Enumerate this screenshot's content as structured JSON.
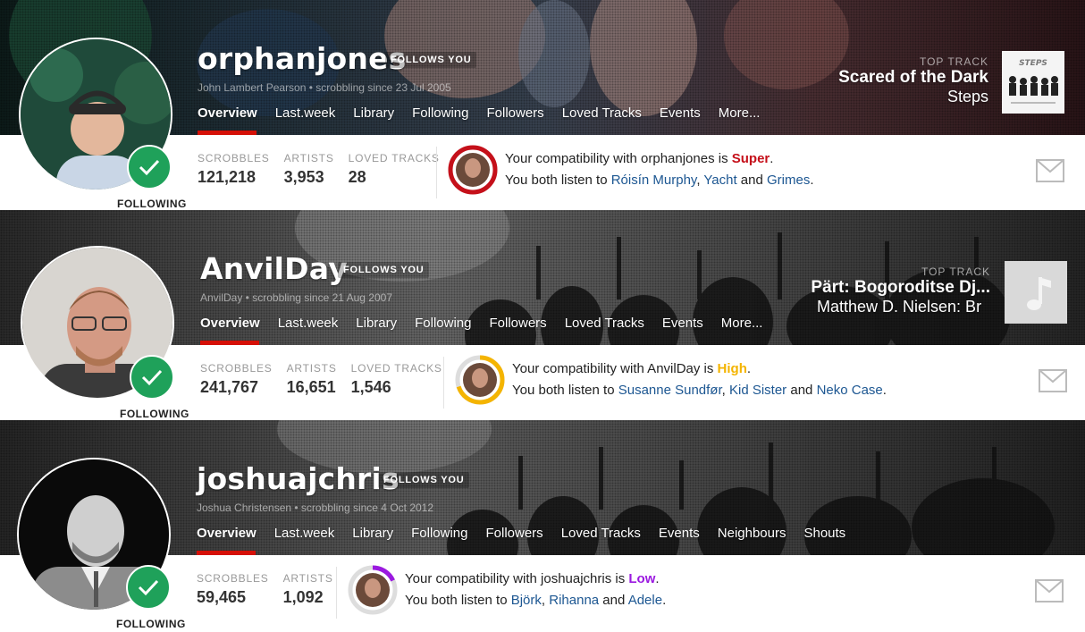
{
  "users": [
    {
      "username": "orphanjones",
      "follows_badge": "FOLLOWS YOU",
      "subline": "John Lambert Pearson • scrobbling since 23 Jul 2005",
      "nav": [
        "Overview",
        "Last.week",
        "Library",
        "Following",
        "Followers",
        "Loved Tracks",
        "Events",
        "More..."
      ],
      "top_track_label": "TOP TRACK",
      "top_track_name": "Scared of the Dark",
      "top_track_artist": "Steps",
      "stats": [
        {
          "label": "SCROBBLES",
          "value": "121,218"
        },
        {
          "label": "ARTISTS",
          "value": "3,953"
        },
        {
          "label": "LOVED TRACKS",
          "value": "28"
        }
      ],
      "compat_prefix": "Your compatibility with orphanjones is ",
      "compat_level": "Super",
      "compat_color": "#c5101a",
      "compat_fraction": 1.0,
      "listen_prefix": "You both listen to ",
      "artists": [
        "Róisín Murphy",
        "Yacht",
        "Grimes"
      ],
      "following_label": "FOLLOWING"
    },
    {
      "username": "AnvilDay",
      "follows_badge": "FOLLOWS YOU",
      "subline": "AnvilDay • scrobbling since 21 Aug 2007",
      "nav": [
        "Overview",
        "Last.week",
        "Library",
        "Following",
        "Followers",
        "Loved Tracks",
        "Events",
        "More..."
      ],
      "top_track_label": "TOP TRACK",
      "top_track_name": "Pärt: Bogoroditse Dj...",
      "top_track_artist": "Matthew D. Nielsen: Br",
      "stats": [
        {
          "label": "SCROBBLES",
          "value": "241,767"
        },
        {
          "label": "ARTISTS",
          "value": "16,651"
        },
        {
          "label": "LOVED TRACKS",
          "value": "1,546"
        }
      ],
      "compat_prefix": "Your compatibility with AnvilDay is ",
      "compat_level": "High",
      "compat_color": "#f4b400",
      "compat_fraction": 0.7,
      "listen_prefix": "You both listen to ",
      "artists": [
        "Susanne Sundfør",
        "Kid Sister",
        "Neko Case"
      ],
      "following_label": "FOLLOWING"
    },
    {
      "username": "joshuajchris",
      "follows_badge": "FOLLOWS YOU",
      "subline": "Joshua Christensen • scrobbling since 4 Oct 2012",
      "nav": [
        "Overview",
        "Last.week",
        "Library",
        "Following",
        "Followers",
        "Loved Tracks",
        "Events",
        "Neighbours",
        "Shouts"
      ],
      "stats": [
        {
          "label": "SCROBBLES",
          "value": "59,465"
        },
        {
          "label": "ARTISTS",
          "value": "1,092"
        }
      ],
      "compat_prefix": "Your compatibility with joshuajchris is ",
      "compat_level": "Low",
      "compat_color": "#9b19e0",
      "compat_fraction": 0.18,
      "listen_prefix": "You both listen to ",
      "artists": [
        "Björk",
        "Rihanna",
        "Adele"
      ],
      "following_label": "FOLLOWING"
    }
  ],
  "conjunction_and": " and ",
  "list_separator": ", ",
  "period": ".",
  "cover_steps_text": "STEPS",
  "colors": {
    "accent": "#d51007",
    "following_green": "#1fa15a",
    "link": "#1d5792"
  }
}
